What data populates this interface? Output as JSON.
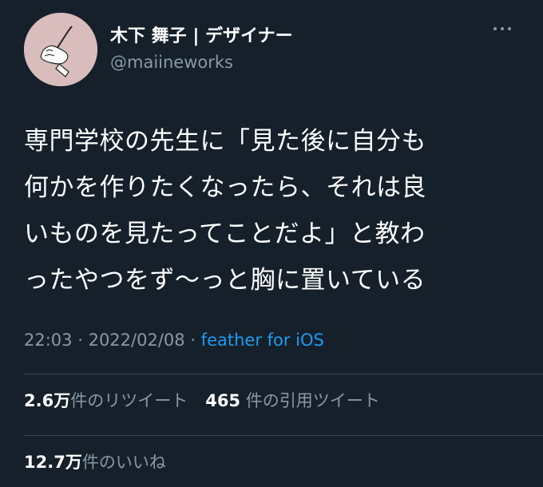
{
  "user": {
    "display_name": "木下 舞子 | デザイナー",
    "handle": "@maiineworks"
  },
  "tweet": {
    "lines": [
      "専門学校の先生に「見た後に自分も",
      "何かを作りたくなったら、それは良",
      "いものを見たってことだよ」と教わ",
      "ったやつをず〜っと胸に置いている"
    ],
    "time": "22:03",
    "date": "2022/02/08",
    "separator": "·",
    "source": "feather for iOS"
  },
  "stats": {
    "retweets_count": "2.6万",
    "retweets_label": "件のリツイート",
    "quotes_count": "465",
    "quotes_label": "件の引用ツイート",
    "likes_count": "12.7万",
    "likes_label": "件のいいね"
  },
  "icons": {
    "avatar": "hand-holding-pen-illustration",
    "more": "more-icon"
  },
  "colors": {
    "background": "#15202b",
    "primary_text": "#ffffff",
    "secondary_text": "#8b98a5",
    "link": "#1d9bf0",
    "divider": "#38444d",
    "avatar_bg": "#d9bcbc"
  }
}
